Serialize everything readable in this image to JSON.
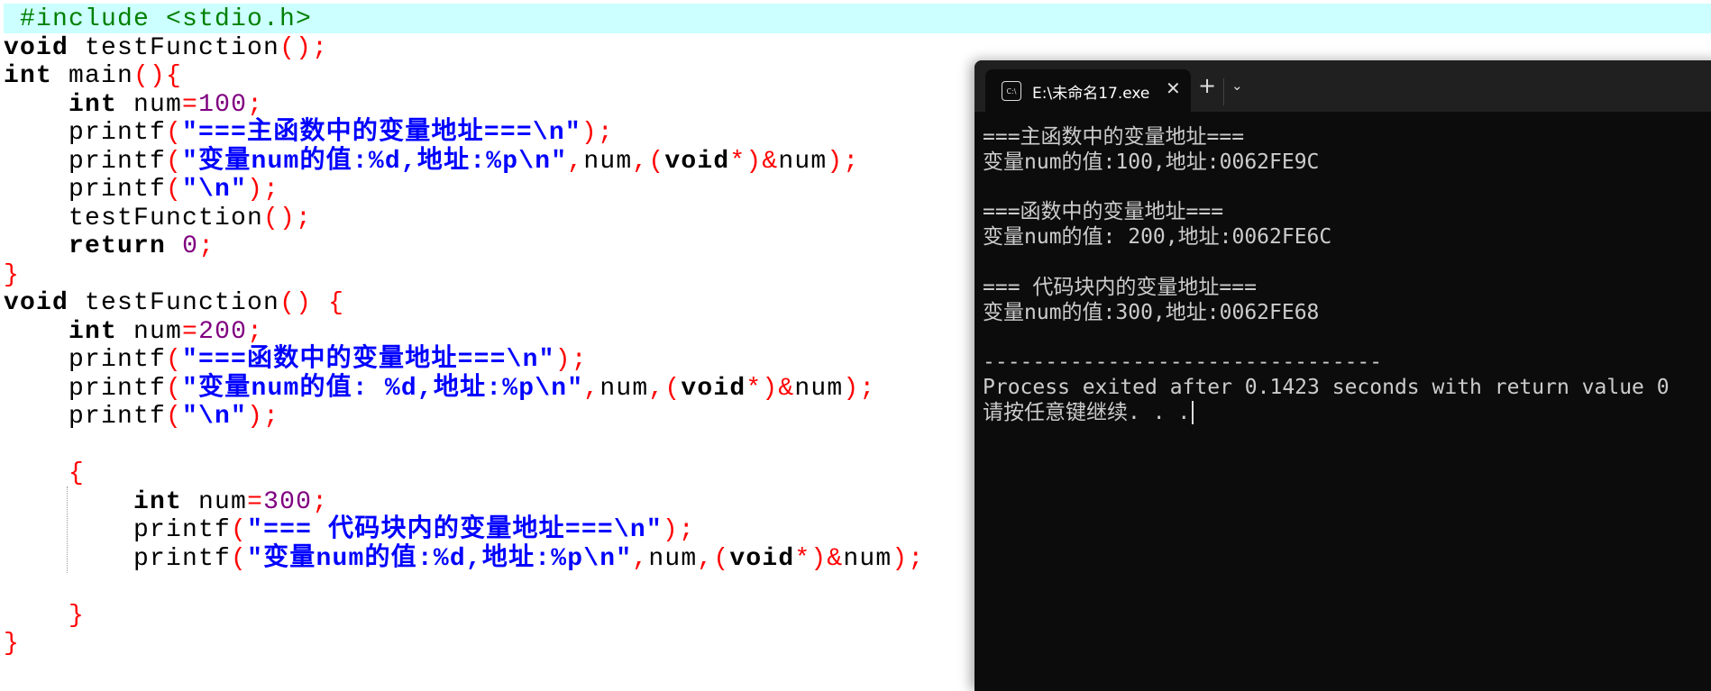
{
  "editor": {
    "lines": [
      [
        [
          "pre",
          " #include <stdio.h>"
        ]
      ],
      [
        [
          "kw",
          "void"
        ],
        [
          "id",
          " testFunction"
        ],
        [
          "p",
          "();"
        ]
      ],
      [
        [
          "kw",
          "int"
        ],
        [
          "id",
          " main"
        ],
        [
          "p",
          "(){"
        ]
      ],
      [
        [
          "id",
          "    "
        ],
        [
          "kw",
          "int"
        ],
        [
          "id",
          " num"
        ],
        [
          "p",
          "="
        ],
        [
          "num",
          "100"
        ],
        [
          "p",
          ";"
        ]
      ],
      [
        [
          "id",
          "    printf"
        ],
        [
          "p",
          "("
        ],
        [
          "str",
          "\"===主函数中的变量地址===\\n\""
        ],
        [
          "p",
          ");"
        ]
      ],
      [
        [
          "id",
          "    printf"
        ],
        [
          "p",
          "("
        ],
        [
          "str",
          "\"变量num的值:%d,地址:%p\\n\""
        ],
        [
          "p",
          ","
        ],
        [
          "id",
          "num"
        ],
        [
          "p",
          ",("
        ],
        [
          "kw",
          "void"
        ],
        [
          "p",
          "*)&"
        ],
        [
          "id",
          "num"
        ],
        [
          "p",
          ");"
        ]
      ],
      [
        [
          "id",
          "    printf"
        ],
        [
          "p",
          "("
        ],
        [
          "str",
          "\"\\n\""
        ],
        [
          "p",
          ");"
        ]
      ],
      [
        [
          "id",
          "    testFunction"
        ],
        [
          "p",
          "();"
        ]
      ],
      [
        [
          "id",
          "    "
        ],
        [
          "kw",
          "return"
        ],
        [
          "id",
          " "
        ],
        [
          "num",
          "0"
        ],
        [
          "p",
          ";"
        ]
      ],
      [
        [
          "p",
          "}"
        ]
      ],
      [
        [
          "kw",
          "void"
        ],
        [
          "id",
          " testFunction"
        ],
        [
          "p",
          "() {"
        ]
      ],
      [
        [
          "id",
          "    "
        ],
        [
          "kw",
          "int"
        ],
        [
          "id",
          " num"
        ],
        [
          "p",
          "="
        ],
        [
          "num",
          "200"
        ],
        [
          "p",
          ";"
        ]
      ],
      [
        [
          "id",
          "    printf"
        ],
        [
          "p",
          "("
        ],
        [
          "str",
          "\"===函数中的变量地址===\\n\""
        ],
        [
          "p",
          ");"
        ]
      ],
      [
        [
          "id",
          "    printf"
        ],
        [
          "p",
          "("
        ],
        [
          "str",
          "\"变量num的值: %d,地址:%p\\n\""
        ],
        [
          "p",
          ","
        ],
        [
          "id",
          "num"
        ],
        [
          "p",
          ",("
        ],
        [
          "kw",
          "void"
        ],
        [
          "p",
          "*)&"
        ],
        [
          "id",
          "num"
        ],
        [
          "p",
          ");"
        ]
      ],
      [
        [
          "id",
          "    printf"
        ],
        [
          "p",
          "("
        ],
        [
          "str",
          "\"\\n\""
        ],
        [
          "p",
          ");"
        ]
      ],
      [],
      [
        [
          "id",
          "    "
        ],
        [
          "p",
          "{"
        ]
      ],
      [
        [
          "id",
          "        "
        ],
        [
          "kw",
          "int"
        ],
        [
          "id",
          " num"
        ],
        [
          "p",
          "="
        ],
        [
          "num",
          "300"
        ],
        [
          "p",
          ";"
        ]
      ],
      [
        [
          "id",
          "        printf"
        ],
        [
          "p",
          "("
        ],
        [
          "str",
          "\"=== 代码块内的变量地址===\\n\""
        ],
        [
          "p",
          ");"
        ]
      ],
      [
        [
          "id",
          "        printf"
        ],
        [
          "p",
          "("
        ],
        [
          "str",
          "\"变量num的值:%d,地址:%p\\n\""
        ],
        [
          "p",
          ","
        ],
        [
          "id",
          "num"
        ],
        [
          "p",
          ",("
        ],
        [
          "kw",
          "void"
        ],
        [
          "p",
          "*)&"
        ],
        [
          "id",
          "num"
        ],
        [
          "p",
          ");"
        ]
      ],
      [],
      [
        [
          "id",
          "    "
        ],
        [
          "p",
          "}"
        ]
      ],
      [
        [
          "p",
          "}"
        ]
      ]
    ]
  },
  "terminal": {
    "tab_icon": "C:\\",
    "tab_title": "E:\\未命名17.exe",
    "close_label": "✕",
    "new_tab_label": "+",
    "dropdown_label": "⌄",
    "output": [
      "===主函数中的变量地址===",
      "变量num的值:100,地址:0062FE9C",
      "",
      "===函数中的变量地址===",
      "变量num的值: 200,地址:0062FE6C",
      "",
      "=== 代码块内的变量地址===",
      "变量num的值:300,地址:0062FE68",
      "",
      "--------------------------------",
      "Process exited after 0.1423 seconds with return value 0",
      "请按任意键继续. . ."
    ]
  }
}
